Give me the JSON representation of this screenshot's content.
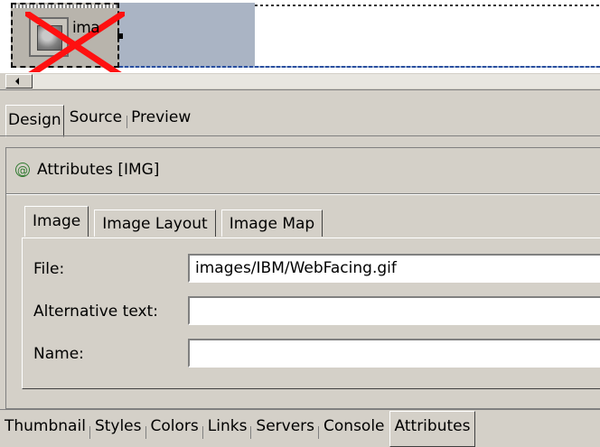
{
  "canvas": {
    "image_label": "ima"
  },
  "page_tabs": [
    {
      "label": "Design",
      "active": true
    },
    {
      "label": "Source",
      "active": false
    },
    {
      "label": "Preview",
      "active": false
    }
  ],
  "attributes_view": {
    "icon": "at-sign-icon",
    "title": "Attributes [IMG]",
    "tabs": [
      {
        "label": "Image",
        "active": true
      },
      {
        "label": "Image Layout",
        "active": false
      },
      {
        "label": "Image Map",
        "active": false
      }
    ],
    "fields": {
      "file_label": "File:",
      "file_value": "images/IBM/WebFacing.gif",
      "alt_label": "Alternative text:",
      "alt_value": "",
      "name_label": "Name:",
      "name_value": ""
    }
  },
  "bottom_tabs": [
    {
      "label": "Thumbnail",
      "active": false
    },
    {
      "label": "Styles",
      "active": false
    },
    {
      "label": "Colors",
      "active": false
    },
    {
      "label": "Links",
      "active": false
    },
    {
      "label": "Servers",
      "active": false
    },
    {
      "label": "Console",
      "active": false
    },
    {
      "label": "Attributes",
      "active": true
    }
  ],
  "colors": {
    "selection_fill": "#aab4c4",
    "broken_x": "#ff1010",
    "at_icon": "#2f7a2f"
  }
}
